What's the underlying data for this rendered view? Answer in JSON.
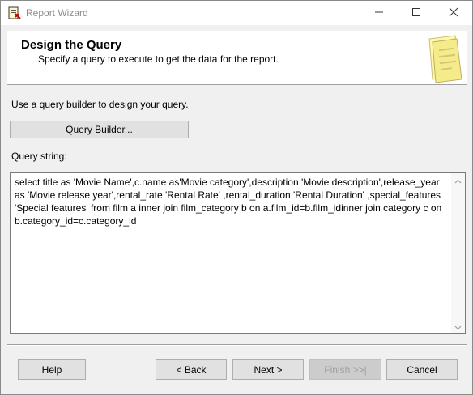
{
  "window": {
    "title": "Report Wizard",
    "icon": "report-wizard-icon",
    "controls": [
      "minimize-icon",
      "maximize-icon",
      "close-icon"
    ]
  },
  "header": {
    "title": "Design the Query",
    "subtitle": "Specify a query to execute to get the data for the report.",
    "art_icon": "document-page-icon"
  },
  "body": {
    "instruction": "Use a query builder to design your query.",
    "query_builder_label": "Query Builder...",
    "query_string_label": "Query string:",
    "query_string": "select title as 'Movie Name',c.name as'Movie category',description 'Movie description',release_year as 'Movie release year',rental_rate 'Rental Rate' ,rental_duration 'Rental Duration' ,special_features 'Special features' from film a inner join film_category b on a.film_id=b.film_idinner join category c on b.category_id=c.category_id"
  },
  "footer": {
    "help_label": "Help",
    "back_label": "< Back",
    "next_label": "Next >",
    "finish_label": "Finish >>|",
    "cancel_label": "Cancel"
  },
  "colors": {
    "window_bg": "#f0f0f0",
    "title_text": "#8c8c8c",
    "button_bg": "#e1e1e1",
    "button_border": "#adadad",
    "disabled_text": "#a0a0a0"
  }
}
